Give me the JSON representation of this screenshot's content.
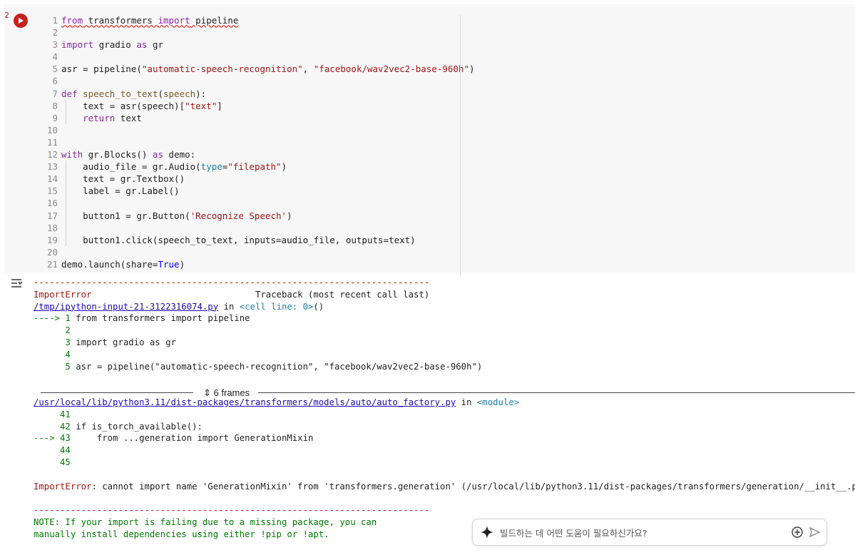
{
  "cell": {
    "run_icon": "play-icon",
    "left_mark": "2",
    "lines": [
      {
        "n": "1",
        "segs": [
          [
            "kw",
            "from"
          ],
          [
            "plain",
            " transformers "
          ],
          [
            "kw",
            "import"
          ],
          [
            "plain",
            " pipeline"
          ]
        ],
        "warn": true
      },
      {
        "n": "2",
        "segs": []
      },
      {
        "n": "3",
        "segs": [
          [
            "kw",
            "import"
          ],
          [
            "plain",
            " gradio "
          ],
          [
            "kw",
            "as"
          ],
          [
            "plain",
            " gr"
          ]
        ]
      },
      {
        "n": "4",
        "segs": []
      },
      {
        "n": "5",
        "segs": [
          [
            "plain",
            "asr = pipeline("
          ],
          [
            "str",
            "\"automatic-speech-recognition\""
          ],
          [
            "plain",
            ", "
          ],
          [
            "str",
            "\"facebook/wav2vec2-base-960h\""
          ],
          [
            "plain",
            ")"
          ]
        ]
      },
      {
        "n": "6",
        "segs": []
      },
      {
        "n": "7",
        "segs": [
          [
            "kw",
            "def"
          ],
          [
            "plain",
            " "
          ],
          [
            "fn",
            "speech_to_text"
          ],
          [
            "plain",
            "("
          ],
          [
            "fn",
            "speech"
          ],
          [
            "plain",
            "):"
          ]
        ]
      },
      {
        "n": "8",
        "segs": [
          [
            "plain",
            "    text = asr(speech)["
          ],
          [
            "str",
            "\"text\""
          ],
          [
            "plain",
            "]"
          ]
        ],
        "guide": true
      },
      {
        "n": "9",
        "segs": [
          [
            "plain",
            "    "
          ],
          [
            "kw",
            "return"
          ],
          [
            "plain",
            " text"
          ]
        ],
        "guide": true
      },
      {
        "n": "10",
        "segs": []
      },
      {
        "n": "11",
        "segs": []
      },
      {
        "n": "12",
        "segs": [
          [
            "kw",
            "with"
          ],
          [
            "plain",
            " gr.Blocks() "
          ],
          [
            "kw",
            "as"
          ],
          [
            "plain",
            " demo:"
          ]
        ]
      },
      {
        "n": "13",
        "segs": [
          [
            "plain",
            "    audio_file = gr.Audio("
          ],
          [
            "cyan",
            "type"
          ],
          [
            "plain",
            "="
          ],
          [
            "str",
            "\"filepath\""
          ],
          [
            "plain",
            ")"
          ]
        ],
        "guide": true
      },
      {
        "n": "14",
        "segs": [
          [
            "plain",
            "    text = gr.Textbox()"
          ]
        ],
        "guide": true
      },
      {
        "n": "15",
        "segs": [
          [
            "plain",
            "    label = gr.Label()"
          ]
        ],
        "guide": true
      },
      {
        "n": "16",
        "segs": [],
        "guide": true
      },
      {
        "n": "17",
        "segs": [
          [
            "plain",
            "    button1 = gr.Button("
          ],
          [
            "str",
            "'Recognize Speech'"
          ],
          [
            "plain",
            ")"
          ]
        ],
        "guide": true
      },
      {
        "n": "18",
        "segs": [],
        "guide": true
      },
      {
        "n": "19",
        "segs": [
          [
            "plain",
            "    button1.click(speech_to_text, inputs=audio_file, outputs=text)"
          ]
        ],
        "guide": true
      },
      {
        "n": "20",
        "segs": []
      },
      {
        "n": "21",
        "segs": [
          [
            "plain",
            "demo.launch(share="
          ],
          [
            "bool",
            "True"
          ],
          [
            "plain",
            ")"
          ]
        ]
      }
    ]
  },
  "output": {
    "collapse_icon": "output-collapse-icon",
    "lines": [
      [
        [
          "dash",
          "---------------------------------------------------------------------------"
        ]
      ],
      [
        [
          "err",
          "ImportError"
        ],
        [
          "plain",
          "                               Traceback (most recent call last)"
        ]
      ],
      [
        [
          "link",
          "/tmp/ipython-input-21-3122316074.py"
        ],
        [
          "plain",
          " in "
        ],
        [
          "cyan",
          "<cell line: 0>"
        ],
        [
          "plain",
          "()"
        ]
      ],
      [
        [
          "grn",
          "----> 1 "
        ],
        [
          "plain",
          "from transformers import pipeline"
        ]
      ],
      [
        [
          "grn",
          "      2"
        ]
      ],
      [
        [
          "grn",
          "      3 "
        ],
        [
          "plain",
          "import gradio as gr"
        ]
      ],
      [
        [
          "grn",
          "      4"
        ]
      ],
      [
        [
          "grn",
          "      5 "
        ],
        [
          "plain",
          "asr = pipeline(\"automatic-speech-recognition\", \"facebook/wav2vec2-base-960h\")"
        ]
      ],
      [],
      [],
      [
        [
          "link",
          "/usr/local/lib/python3.11/dist-packages/transformers/models/auto/auto_factory.py"
        ],
        [
          "plain",
          " in "
        ],
        [
          "cyan",
          "<module>"
        ]
      ],
      [
        [
          "grn",
          "     41"
        ]
      ],
      [
        [
          "grn",
          "     42 "
        ],
        [
          "plain",
          "if is_torch_available():"
        ]
      ],
      [
        [
          "grn",
          "---> 43 "
        ],
        [
          "plain",
          "    from ...generation import GenerationMixin"
        ]
      ],
      [
        [
          "grn",
          "     44"
        ]
      ],
      [
        [
          "grn",
          "     45"
        ]
      ],
      [],
      [
        [
          "err",
          "ImportError"
        ],
        [
          "plain",
          ": cannot import name 'GenerationMixin' from 'transformers.generation' (/usr/local/lib/python3.11/dist-packages/transformers/generation/__init__.py)"
        ]
      ],
      [],
      [
        [
          "dash",
          "---------------------------------------------------------------------------"
        ]
      ],
      [
        [
          "grn",
          "NOTE: If your import is failing due to a missing package, you can"
        ]
      ],
      [
        [
          "grn",
          "manually install dependencies using either !pip or !apt."
        ]
      ]
    ],
    "frames_label": "6 frames",
    "frames_icon": "expand-vertical-icon"
  },
  "chat": {
    "placeholder": "빌드하는 데 어떤 도움이 필요하신가요?",
    "spark_icon": "sparkle-icon",
    "add_icon": "add-circle-icon",
    "send_icon": "send-icon"
  }
}
